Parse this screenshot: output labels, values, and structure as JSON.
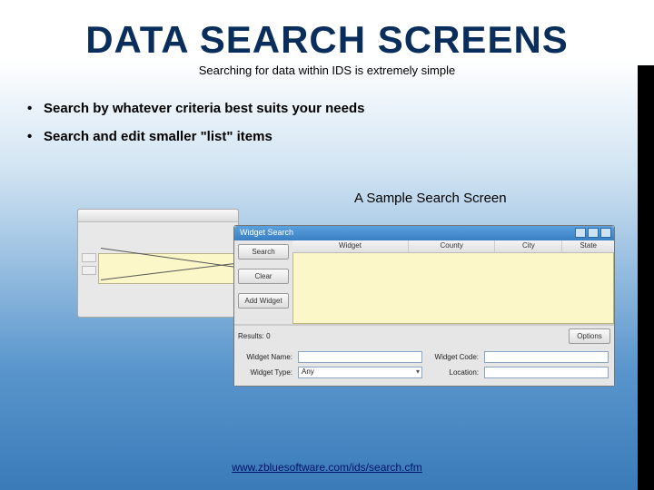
{
  "title": "DATA SEARCH SCREENS",
  "subtitle": "Searching for data within IDS is extremely simple",
  "bullets": [
    "Search by whatever criteria best suits your needs",
    "Search and edit smaller \"list\" items"
  ],
  "caption": "A Sample Search Screen",
  "search_window": {
    "title": "Widget Search",
    "buttons": {
      "search": "Search",
      "clear": "Clear",
      "add": "Add Widget",
      "options": "Options"
    },
    "columns": [
      "Widget",
      "County",
      "City",
      "State"
    ],
    "results_label": "Results:",
    "results_count": "0",
    "form": {
      "name_label": "Widget Name:",
      "type_label": "Widget Type:",
      "type_value": "Any",
      "code_label": "Widget Code:",
      "location_label": "Location:"
    }
  },
  "footer_url": "www.zbluesoftware.com/ids/search.cfm"
}
